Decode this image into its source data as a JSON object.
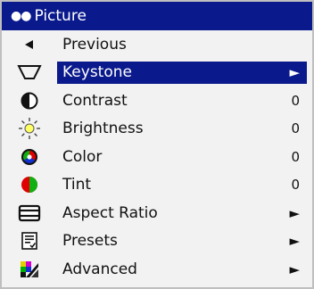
{
  "menu": {
    "title": "Picture",
    "header_icon": "two-dots-icon",
    "accent_color": "#0a1a8c",
    "items": [
      {
        "label": "Previous",
        "icon": "left-triangle-icon",
        "value": ""
      },
      {
        "label": "Keystone",
        "icon": "keystone-trapezoid-icon",
        "value": "►",
        "selected": true
      },
      {
        "label": "Contrast",
        "icon": "contrast-halfcircle-icon",
        "value": "0"
      },
      {
        "label": "Brightness",
        "icon": "sun-icon",
        "value": "0"
      },
      {
        "label": "Color",
        "icon": "color-wheel-icon",
        "value": "0"
      },
      {
        "label": "Tint",
        "icon": "tint-circle-icon",
        "value": "0"
      },
      {
        "label": "Aspect Ratio",
        "icon": "aspect-ratio-icon",
        "value": "►"
      },
      {
        "label": "Presets",
        "icon": "presets-icon",
        "value": "►"
      },
      {
        "label": "Advanced",
        "icon": "advanced-pattern-icon",
        "value": "►"
      }
    ]
  }
}
